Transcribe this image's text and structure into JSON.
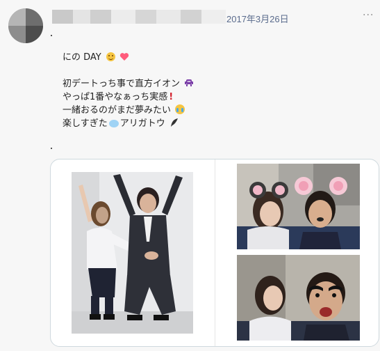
{
  "post": {
    "date": "2017年3月26日",
    "more": "···",
    "lines": [
      {
        "text": "にの DAY"
      },
      {
        "text": "初デートっち事で直方イオン"
      },
      {
        "text": "やっぱ1番やなぁっち実感"
      },
      {
        "text": "一緒おるのがまだ夢みたい"
      },
      {
        "text_a": "楽しすぎた",
        "text_b": "アリガトウ"
      }
    ],
    "icons": [
      "smiling-face-icon",
      "heart-icon",
      "alien-monster-icon",
      "exclamation-icon",
      "crying-laughing-icon",
      "speech-bubble-icon",
      "feather-icon"
    ]
  },
  "colors": {
    "date": "#5a6b8c",
    "heart": "#ff5c7c",
    "alien": "#7b3fa8",
    "exclaim": "#d21f2b",
    "card_border": "#cfd9de"
  }
}
